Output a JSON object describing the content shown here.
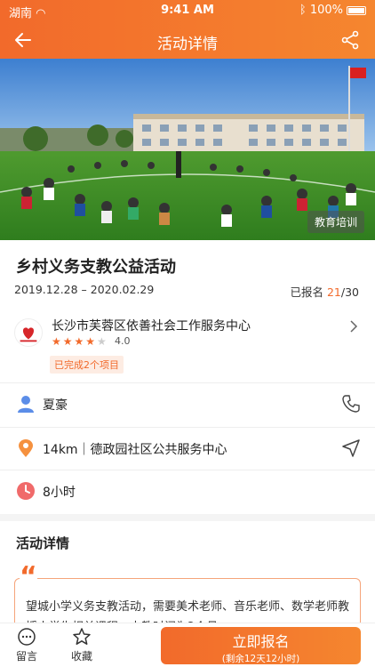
{
  "status_bar": {
    "carrier": "湖南",
    "time": "9:41 AM",
    "battery": "100%"
  },
  "header": {
    "title": "活动详情"
  },
  "hero": {
    "tag": "教育培训"
  },
  "activity": {
    "title": "乡村义务支教公益活动",
    "date_range": "2019.12.28 – 2020.02.29",
    "registered_label": "已报名",
    "registered_current": "21",
    "registered_total": "/30"
  },
  "organization": {
    "name": "长沙市芙蓉区依善社会工作服务中心",
    "rating": "4.0",
    "rating_value": 4,
    "rating_max": 5,
    "completed_badge": "已完成2个项目"
  },
  "details": {
    "contact_name": "夏豪",
    "location": "14km｜德政园社区公共服务中心",
    "duration": "8小时"
  },
  "description": {
    "section_title": "活动详情",
    "text": "望城小学义务支教活动，需要美术老师、音乐老师、数学老师教授小学生相关课程，支教时间为2个月"
  },
  "bottom_bar": {
    "comment_label": "留言",
    "favorite_label": "收藏",
    "signup_label": "立即报名",
    "signup_countdown": "(剩余12天12小时)"
  },
  "colors": {
    "accent": "#f26a2b"
  }
}
